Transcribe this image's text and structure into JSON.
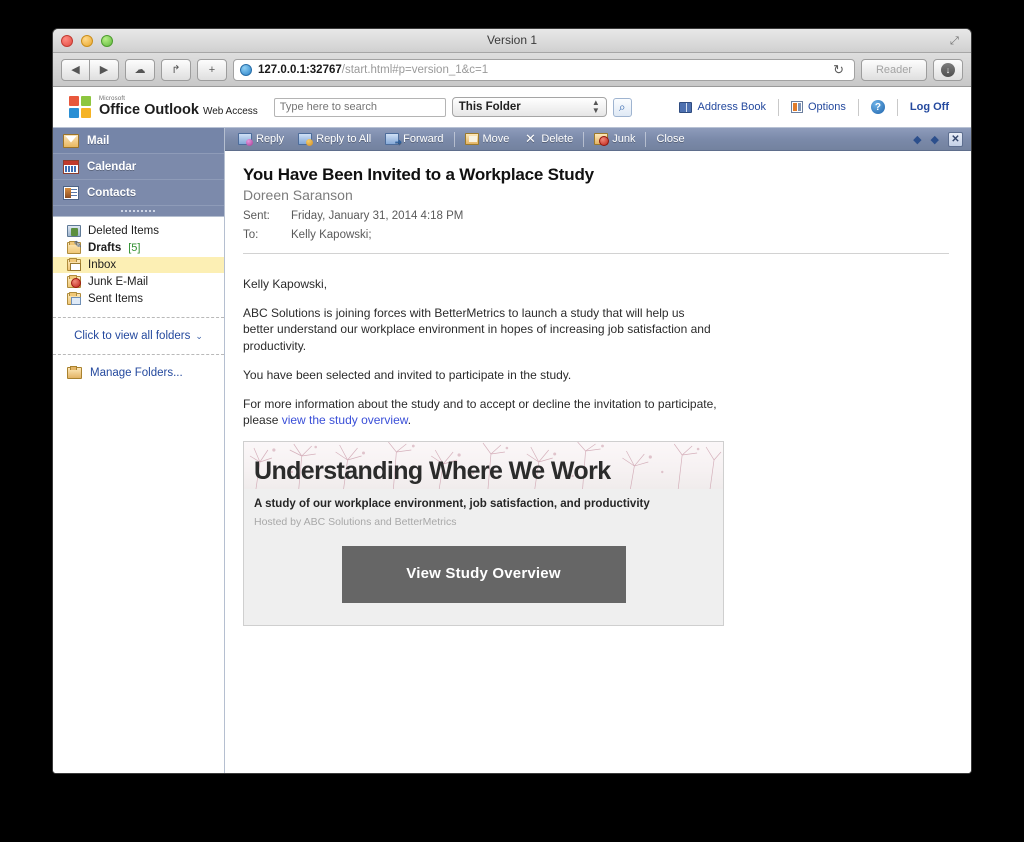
{
  "window": {
    "title": "Version 1",
    "traffic": {
      "close": "close",
      "minimize": "minimize",
      "maximize": "maximize"
    }
  },
  "browser": {
    "back_label": "◀",
    "forward_label": "▶",
    "cloud_label": "☁",
    "share_label": "↱",
    "add_tab_label": "+",
    "url_host": "127.0.0.1:32767",
    "url_path": "/start.html#p=version_1&c=1",
    "reload_label": "↻",
    "reader_label": "Reader",
    "download_label": "↓"
  },
  "owa": {
    "logo": {
      "microsoft": "Microsoft",
      "product": "Office Outlook",
      "suffix": "Web Access"
    },
    "search": {
      "placeholder": "Type here to search",
      "value": "",
      "scope": "This Folder",
      "go_label": "⌕"
    },
    "links": [
      {
        "label": "Address Book",
        "icon": "address-book-icon"
      },
      {
        "label": "Options",
        "icon": "options-icon"
      },
      {
        "label": "",
        "icon": "help-icon"
      },
      {
        "label": "Log Off",
        "icon": ""
      }
    ]
  },
  "sidebar": {
    "modules": [
      {
        "label": "Mail",
        "icon": "mail-icon",
        "active": true
      },
      {
        "label": "Calendar",
        "icon": "calendar-icon",
        "active": false
      },
      {
        "label": "Contacts",
        "icon": "contacts-icon",
        "active": false
      }
    ],
    "folders": [
      {
        "label": "Deleted Items",
        "count": "",
        "icon": "deleted-items-icon",
        "selected": false,
        "bold": false
      },
      {
        "label": "Drafts",
        "count": "[5]",
        "icon": "drafts-icon",
        "selected": false,
        "bold": true
      },
      {
        "label": "Inbox",
        "count": "",
        "icon": "inbox-icon",
        "selected": true,
        "bold": false
      },
      {
        "label": "Junk E-Mail",
        "count": "",
        "icon": "junk-icon",
        "selected": false,
        "bold": false
      },
      {
        "label": "Sent Items",
        "count": "",
        "icon": "sent-items-icon",
        "selected": false,
        "bold": false
      }
    ],
    "all_folders_label": "Click to view all folders",
    "all_folders_chevron": "⌄",
    "manage_folders_label": "Manage Folders..."
  },
  "message_toolbar": {
    "buttons": [
      {
        "label": "Reply",
        "icon": "reply-icon"
      },
      {
        "label": "Reply to All",
        "icon": "reply-all-icon"
      },
      {
        "label": "Forward",
        "icon": "forward-icon"
      },
      {
        "label": "Move",
        "icon": "move-icon"
      },
      {
        "label": "Delete",
        "icon": "delete-icon"
      },
      {
        "label": "Junk",
        "icon": "junk-icon"
      },
      {
        "label": "Close",
        "icon": ""
      }
    ],
    "prev_label": "◆",
    "next_label": "◆",
    "close_label": "✕"
  },
  "message": {
    "subject": "You Have Been Invited to a Workplace Study",
    "from": "Doreen Saranson",
    "sent_label": "Sent:",
    "sent_value": "Friday, January 31, 2014 4:18 PM",
    "to_label": "To:",
    "to_value": "Kelly Kapowski;",
    "greeting": "Kelly Kapowski,",
    "paragraph1": "ABC Solutions is joining forces with BetterMetrics to launch a study that will help us better understand our workplace environment in hopes of increasing job satisfaction and productivity.",
    "paragraph2": "You have been selected and invited to participate in the study.",
    "paragraph3_before": "For more information about the study and to accept or decline the invitation to participate, please ",
    "paragraph3_link": "view the study overview",
    "paragraph3_after": "."
  },
  "promo": {
    "title": "Understanding Where We Work",
    "subtitle": "A study of our workplace environment, job satisfaction, and productivity",
    "hosted_by": "Hosted by ABC Solutions and BetterMetrics",
    "cta_label": "View Study Overview",
    "cta_color": "#666666",
    "panel_bg": "#efefef"
  }
}
